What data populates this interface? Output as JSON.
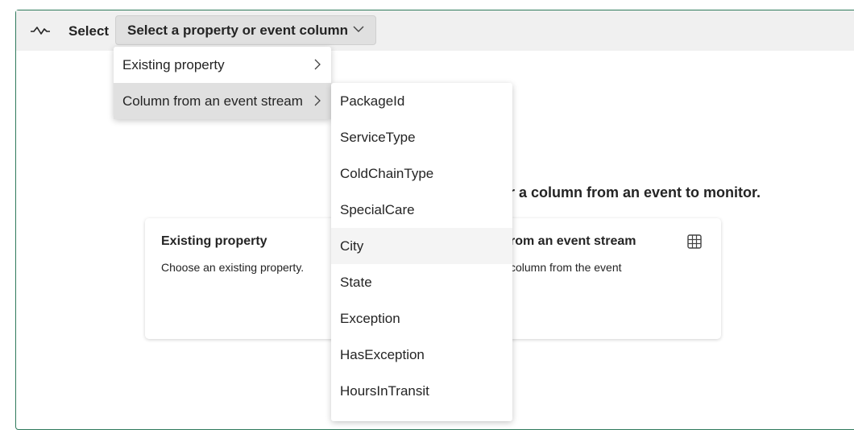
{
  "toolbar": {
    "icon": "waveform-icon",
    "select_label": "Select",
    "dropdown_label": "Select a property or event column"
  },
  "main": {
    "heading_partial": "r a column from an event to monitor."
  },
  "cards": [
    {
      "title": "Existing property",
      "description": "Choose an existing property."
    },
    {
      "title_partial": "rom an event stream",
      "description_partial": "column from the event",
      "icon": "table-icon"
    }
  ],
  "menu": {
    "items": [
      {
        "label": "Existing property"
      },
      {
        "label": "Column from an event stream"
      }
    ]
  },
  "submenu": {
    "items": [
      "PackageId",
      "ServiceType",
      "ColdChainType",
      "SpecialCare",
      "City",
      "State",
      "Exception",
      "HasException",
      "HoursInTransit"
    ],
    "hovered": "City"
  },
  "colors": {
    "frame_border": "#2f7a5c",
    "toolbar_bg": "#f0f0f0",
    "button_bg": "#e0e0e0"
  }
}
